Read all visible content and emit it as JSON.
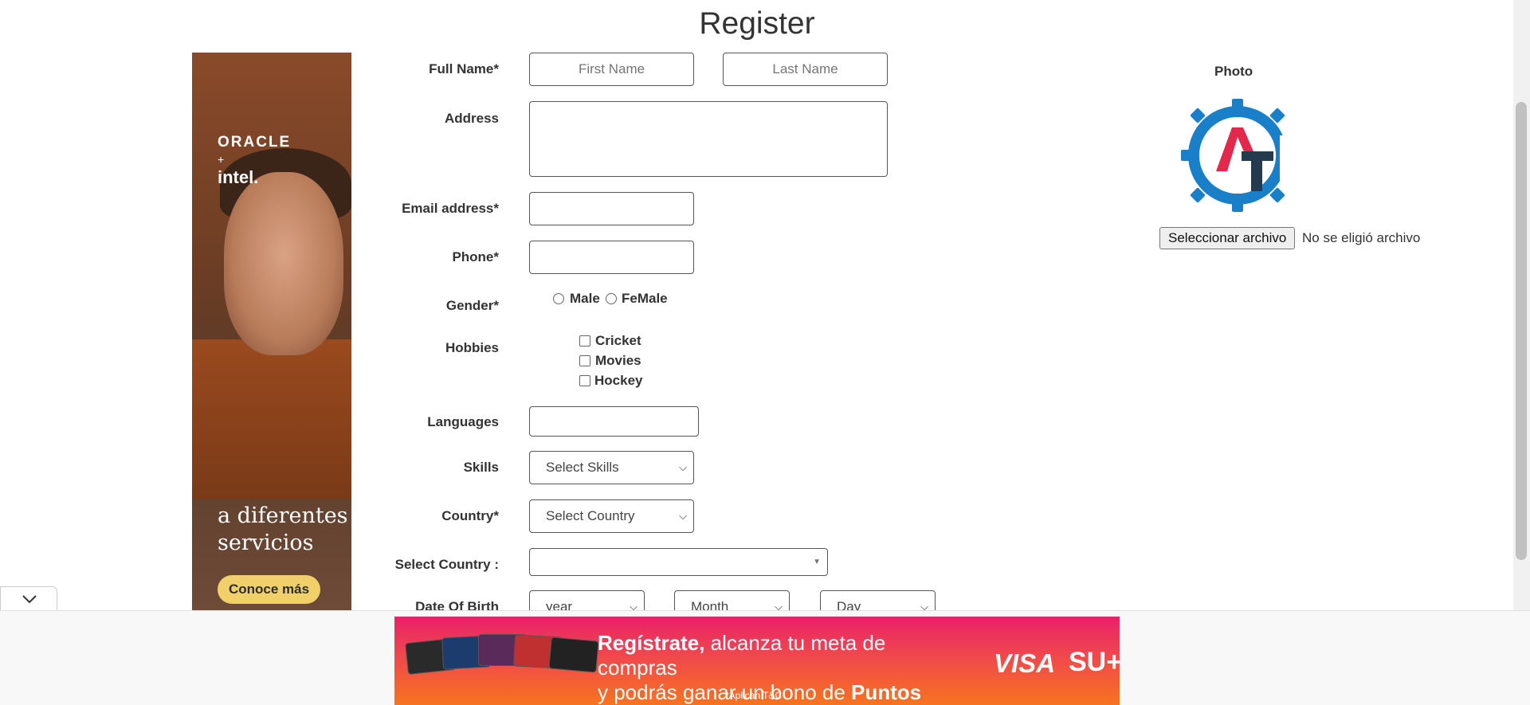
{
  "page": {
    "title": "Register"
  },
  "side_ad": {
    "brand1": "ORACLE",
    "brand_plus": "+",
    "brand2": "intel.",
    "tagline": "a diferentes servicios",
    "cta": "Conoce más"
  },
  "form": {
    "full_name_label": "Full Name*",
    "first_name_placeholder": "First Name",
    "last_name_placeholder": "Last Name",
    "address_label": "Address",
    "email_label": "Email address*",
    "phone_label": "Phone*",
    "gender_label": "Gender*",
    "gender_options": [
      "Male",
      "FeMale"
    ],
    "hobbies_label": "Hobbies",
    "hobbies": [
      "Cricket",
      "Movies",
      "Hockey"
    ],
    "languages_label": "Languages",
    "skills_label": "Skills",
    "skills_selected": "Select Skills",
    "country_label": "Country*",
    "country_selected": "Select Country",
    "select_country_label": "Select Country :",
    "select_country_value": "",
    "dob_label": "Date Of Birth",
    "dob_year": "year",
    "dob_month": "Month",
    "dob_day": "Day"
  },
  "photo": {
    "label": "Photo",
    "file_button": "Seleccionar archivo",
    "file_status": "No se eligió archivo"
  },
  "bottom_ad": {
    "line1_bold": "Regístrate,",
    "line1_rest": " alcanza tu meta de compras",
    "line2_start": "y podrás ganar un bono de ",
    "line2_bold": "Puntos SU+.",
    "brand_visa": "VISA",
    "brand_su": "SU+",
    "fine_print": "*Aplican T&C"
  },
  "colors": {
    "placeholder_blue": "#1a9bd7",
    "logo_blue": "#1a7fc9",
    "logo_red": "#e3284b",
    "logo_dark": "#233a4f",
    "ad_pink": "#e9216a",
    "ad_orange": "#f7731f"
  }
}
